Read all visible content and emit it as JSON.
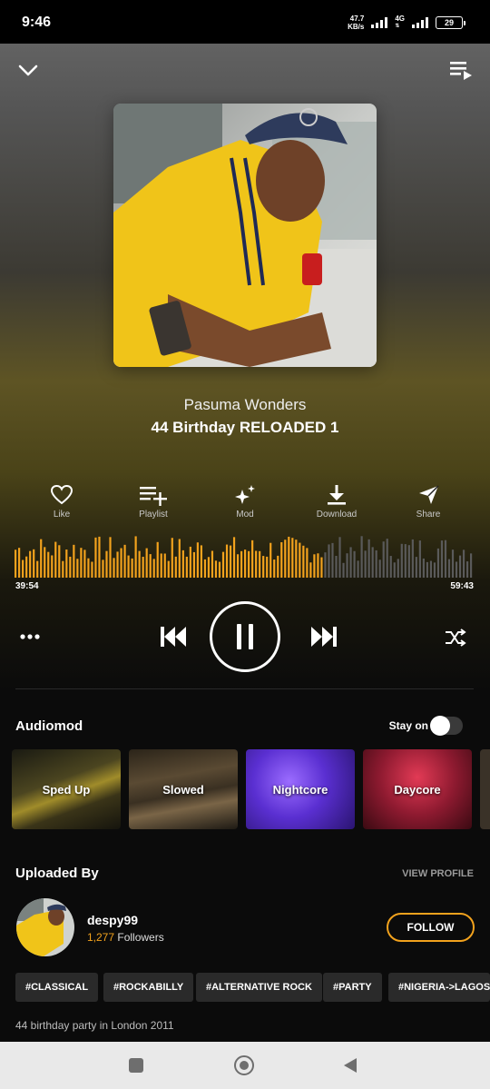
{
  "status": {
    "time": "9:46",
    "net_speed": "47.7",
    "net_unit": "KB/s",
    "network_type": "4G",
    "battery": "29"
  },
  "header": {
    "collapse_icon": "chevron-down-icon",
    "queue_icon": "queue-icon"
  },
  "track": {
    "artist": "Pasuma Wonders",
    "title": "44 Birthday RELOADED 1"
  },
  "actions": [
    {
      "label": "Like",
      "icon": "heart-icon"
    },
    {
      "label": "Playlist",
      "icon": "playlist-add-icon"
    },
    {
      "label": "Mod",
      "icon": "sparkle-icon"
    },
    {
      "label": "Download",
      "icon": "download-icon"
    },
    {
      "label": "Share",
      "icon": "send-icon"
    }
  ],
  "player": {
    "elapsed": "39:54",
    "duration": "59:43",
    "progress": 0.668,
    "state": "playing"
  },
  "audiomod": {
    "title": "Audiomod",
    "stay_on_label": "Stay on",
    "stay_on": false,
    "mods": [
      {
        "label": "Sped Up"
      },
      {
        "label": "Slowed"
      },
      {
        "label": "Nightcore"
      },
      {
        "label": "Daycore"
      }
    ]
  },
  "uploader": {
    "section_title": "Uploaded By",
    "view_profile": "VIEW PROFILE",
    "username": "despy99",
    "followers_count": "1,277",
    "followers_label": "Followers",
    "follow_label": "FOLLOW"
  },
  "tags": [
    "#CLASSICAL",
    "#ROCKABILLY",
    "#ALTERNATIVE ROCK",
    "#PARTY",
    "#NIGERIA->LAGOS->"
  ],
  "description": "44 birthday party in London 2011",
  "colors": {
    "accent": "#f2a21d",
    "wave_played": "#f2a21d",
    "wave_unplayed": "#5a5a5a"
  }
}
